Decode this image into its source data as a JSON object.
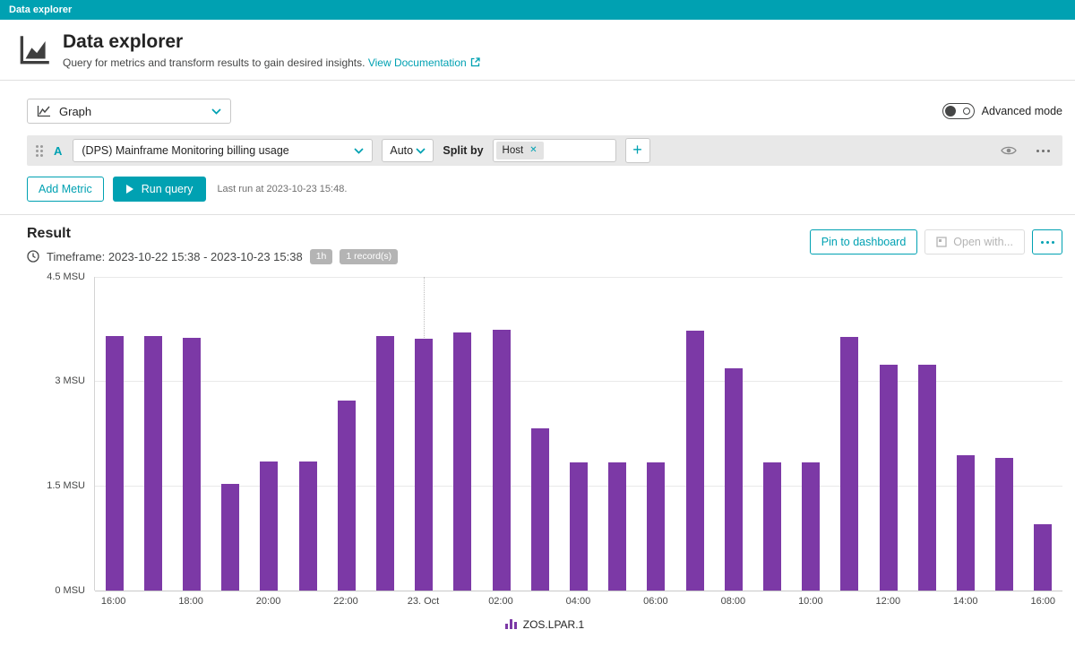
{
  "top_bar": {
    "title": "Data explorer"
  },
  "header": {
    "title": "Data explorer",
    "subtitle": "Query for metrics and transform results to gain desired insights.",
    "doc_link": "View Documentation"
  },
  "controls": {
    "visualization": "Graph",
    "advanced_mode_label": "Advanced mode"
  },
  "query": {
    "letter": "A",
    "metric": "(DPS) Mainframe Monitoring billing usage",
    "resolution": "Auto",
    "split_by_label": "Split by",
    "split_by_chip": "Host"
  },
  "actions": {
    "add_metric": "Add Metric",
    "run_query": "Run query",
    "last_run": "Last run at 2023-10-23 15:48."
  },
  "result": {
    "title": "Result",
    "timeframe": "Timeframe: 2023-10-22 15:38 - 2023-10-23 15:38",
    "badges": [
      "1h",
      "1 record(s)"
    ],
    "pin_button": "Pin to dashboard",
    "open_with_button": "Open with..."
  },
  "icons": {
    "app": "area-chart",
    "visualization": "line-chart",
    "chevron": "chevron-down",
    "drag_handle": "grip-dots",
    "add_split": "+",
    "remove_chip": "✕",
    "play": "triangle-right",
    "eye": "eye",
    "more": "ellipsis",
    "clock": "clock",
    "external_link": "arrow-out-of-box",
    "open_with": "board",
    "legend": "mini-bar-chart"
  },
  "colors": {
    "accent": "#00a1b2",
    "bar": "#7c39a6",
    "query_row_bg": "#e8e8e8",
    "badge_bg": "#b4b4b4"
  },
  "chart_data": {
    "type": "bar",
    "title": "",
    "unit": "MSU",
    "ylim": [
      0,
      4.5
    ],
    "grid": true,
    "legend_position": "bottom",
    "y_ticks_top_down": [
      "4.5 MSU",
      "3 MSU",
      "1.5 MSU",
      "0 MSU"
    ],
    "x_tick_labels": [
      "16:00",
      "18:00",
      "20:00",
      "22:00",
      "23. Oct",
      "02:00",
      "04:00",
      "06:00",
      "08:00",
      "10:00",
      "12:00",
      "14:00",
      "16:00"
    ],
    "x_ticks_every_n_bars": 2,
    "day_separator_bar_index": 8,
    "series": [
      {
        "name": "ZOS.LPAR.1",
        "color": "#7c39a6",
        "values": [
          3.65,
          3.65,
          3.62,
          1.52,
          1.84,
          1.85,
          2.72,
          3.64,
          3.61,
          3.7,
          3.73,
          2.32,
          1.83,
          1.83,
          1.83,
          3.72,
          3.18,
          1.83,
          1.83,
          3.63,
          3.24,
          3.24,
          1.94,
          1.9,
          0.95
        ]
      }
    ]
  }
}
